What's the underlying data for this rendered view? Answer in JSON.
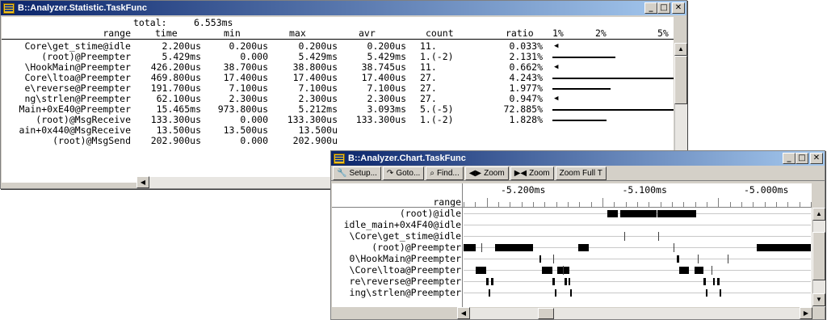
{
  "stat": {
    "title": "B::Analyzer.Statistic.TaskFunc",
    "total_label": "total:",
    "total_value": "6.553ms",
    "headers": [
      "range",
      "time",
      "min",
      "max",
      "avr",
      "count",
      "ratio"
    ],
    "scale": [
      "1%",
      "2%",
      "5%"
    ],
    "rows": [
      {
        "range": "Core\\get_stime@idle",
        "time": "2.200us",
        "min": "0.200us",
        "max": "0.200us",
        "avr": "0.200us",
        "count": "11.",
        "ratio": "0.033%",
        "ratio_pct": 0.033
      },
      {
        "range": "(root)@Preempter",
        "time": "5.429ms",
        "min": "0.000",
        "max": "5.429ms",
        "avr": "5.429ms",
        "count": "1.(-2)",
        "ratio": "2.131%",
        "ratio_pct": 2.131
      },
      {
        "range": "\\HookMain@Preempter",
        "time": "426.200us",
        "min": "38.700us",
        "max": "38.800us",
        "avr": "38.745us",
        "count": "11.",
        "ratio": "0.662%",
        "ratio_pct": 0.662
      },
      {
        "range": "Core\\ltoa@Preempter",
        "time": "469.800us",
        "min": "17.400us",
        "max": "17.400us",
        "avr": "17.400us",
        "count": "27.",
        "ratio": "4.243%",
        "ratio_pct": 4.243
      },
      {
        "range": "e\\reverse@Preempter",
        "time": "191.700us",
        "min": "7.100us",
        "max": "7.100us",
        "avr": "7.100us",
        "count": "27.",
        "ratio": "1.977%",
        "ratio_pct": 1.977
      },
      {
        "range": "ng\\strlen@Preempter",
        "time": "62.100us",
        "min": "2.300us",
        "max": "2.300us",
        "avr": "2.300us",
        "count": "27.",
        "ratio": "0.947%",
        "ratio_pct": 0.947
      },
      {
        "range": "Main+0xE40@Preempter",
        "time": "15.465ms",
        "min": "973.800us",
        "max": "5.212ms",
        "avr": "3.093ms",
        "count": "5.(-5)",
        "ratio": "72.885%",
        "ratio_pct": 72.885
      },
      {
        "range": "(root)@MsgReceive",
        "time": "133.300us",
        "min": "0.000",
        "max": "133.300us",
        "avr": "133.300us",
        "count": "1.(-2)",
        "ratio": "1.828%",
        "ratio_pct": 1.828
      },
      {
        "range": "ain+0x440@MsgReceive",
        "time": "13.500us",
        "min": "13.500us",
        "max": "13.500u",
        "avr": "",
        "count": "",
        "ratio": "",
        "ratio_pct": 0
      },
      {
        "range": "(root)@MsgSend",
        "time": "202.900us",
        "min": "0.000",
        "max": "202.900u",
        "avr": "",
        "count": "",
        "ratio": "",
        "ratio_pct": 0
      }
    ]
  },
  "chart": {
    "title": "B::Analyzer.Chart.TaskFunc",
    "toolbar": {
      "setup": "Setup...",
      "goto": "Goto...",
      "find": "Find...",
      "zoom_in": "Zoom",
      "zoom_out": "Zoom",
      "zoom_full": "Zoom Full T"
    },
    "range_label": "range",
    "time_labels": [
      "-5.200ms",
      "-5.100ms",
      "-5.000ms"
    ],
    "lanes": [
      {
        "name": "(root)@idle",
        "blocks": [
          [
            0.415,
            0.445
          ],
          [
            0.452,
            0.555
          ],
          [
            0.558,
            0.67
          ]
        ],
        "ticks": []
      },
      {
        "name": "idle_main+0x4F40@idle",
        "blocks": [],
        "ticks": []
      },
      {
        "name": "\\Core\\get_stime@idle",
        "blocks": [],
        "ticks": [
          0.463,
          0.561
        ]
      },
      {
        "name": "(root)@Preempter",
        "blocks": [
          [
            0,
            0.035
          ],
          [
            0.09,
            0.2
          ],
          [
            0.33,
            0.36
          ],
          [
            0.845,
            1
          ]
        ],
        "ticks": [
          0.05,
          0.605
        ]
      },
      {
        "name": "0\\HookMain@Preempter",
        "blocks": [
          [
            0.218,
            0.223
          ],
          [
            0.615,
            0.62
          ]
        ],
        "ticks": [
          0.258,
          0.675,
          0.76
        ]
      },
      {
        "name": "\\Core\\ltoa@Preempter",
        "blocks": [
          [
            0.035,
            0.065
          ],
          [
            0.225,
            0.255
          ],
          [
            0.27,
            0.305
          ],
          [
            0.62,
            0.648
          ],
          [
            0.665,
            0.69
          ]
        ],
        "ticks": [
          0.285,
          0.715
        ]
      },
      {
        "name": "re\\reverse@Preempter",
        "blocks": [
          [
            0.065,
            0.072
          ],
          [
            0.078,
            0.085
          ],
          [
            0.255,
            0.262
          ],
          [
            0.29,
            0.297
          ],
          [
            0.302,
            0.308
          ],
          [
            0.69,
            0.697
          ],
          [
            0.718,
            0.724
          ],
          [
            0.73,
            0.737
          ]
        ],
        "ticks": []
      },
      {
        "name": "ing\\strlen@Preempter",
        "blocks": [
          [
            0.072,
            0.076
          ],
          [
            0.262,
            0.266
          ],
          [
            0.308,
            0.312
          ],
          [
            0.697,
            0.701
          ],
          [
            0.737,
            0.741
          ]
        ],
        "ticks": []
      }
    ]
  }
}
